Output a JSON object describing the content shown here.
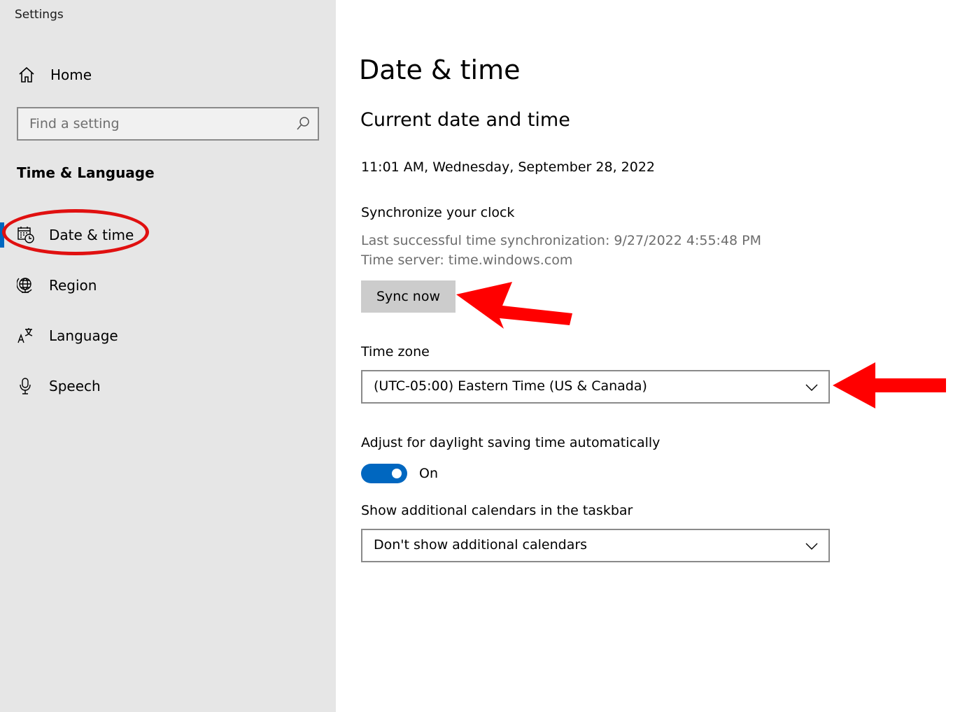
{
  "window": {
    "title": "Settings"
  },
  "sidebar": {
    "home_label": "Home",
    "search": {
      "placeholder": "Find a setting",
      "value": ""
    },
    "section_heading": "Time & Language",
    "items": [
      {
        "label": "Date & time",
        "icon": "calendar-clock-icon",
        "selected": true
      },
      {
        "label": "Region",
        "icon": "globe-icon",
        "selected": false
      },
      {
        "label": "Language",
        "icon": "language-icon",
        "selected": false
      },
      {
        "label": "Speech",
        "icon": "microphone-icon",
        "selected": false
      }
    ]
  },
  "main": {
    "page_title": "Date & time",
    "subtitle": "Current date and time",
    "current_datetime": "11:01 AM, Wednesday, September 28, 2022",
    "sync": {
      "heading": "Synchronize your clock",
      "last_sync": "Last successful time synchronization: 9/27/2022 4:55:48 PM",
      "time_server": "Time server: time.windows.com",
      "button_label": "Sync now"
    },
    "time_zone": {
      "label": "Time zone",
      "selected": "(UTC-05:00) Eastern Time (US & Canada)"
    },
    "dst": {
      "label": "Adjust for daylight saving time automatically",
      "state": "On",
      "enabled": true
    },
    "calendars": {
      "label": "Show additional calendars in the taskbar",
      "selected": "Don't show additional calendars"
    }
  },
  "colors": {
    "accent": "#0067c0",
    "annotation": "#e01010",
    "sidebar_bg": "#e6e6e6",
    "button_bg": "#cccccc"
  }
}
